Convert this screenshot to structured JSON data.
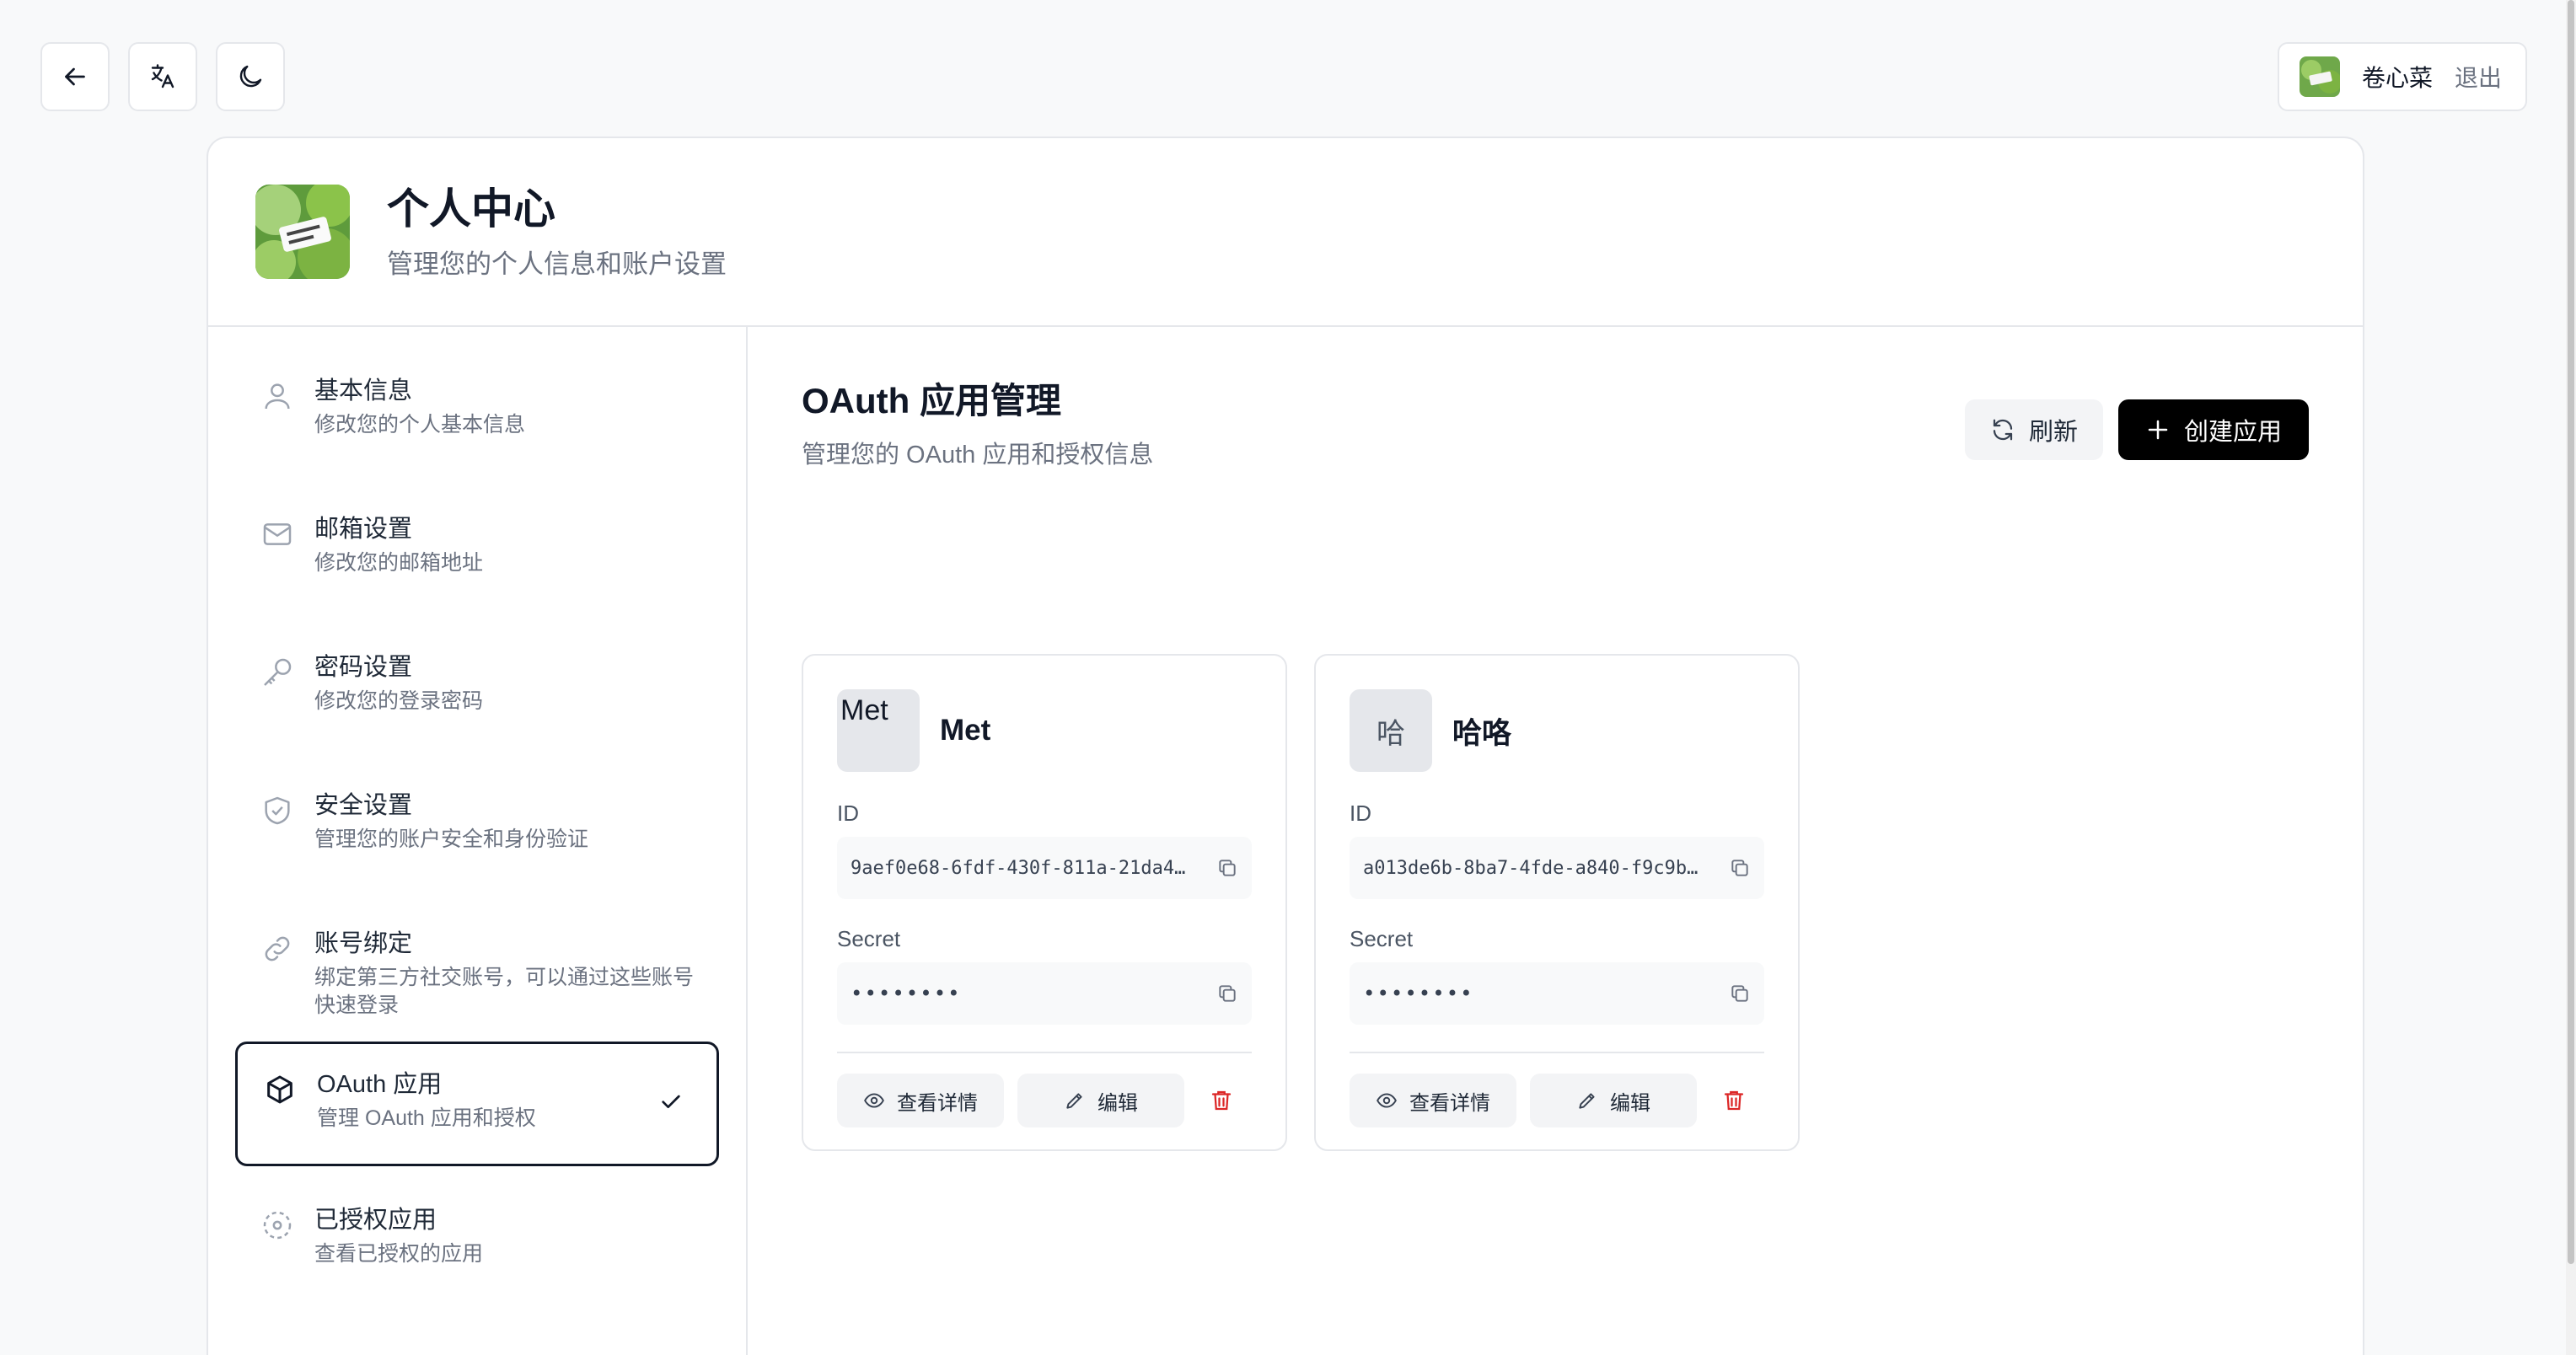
{
  "topbar": {
    "back_icon": "arrow-left-icon",
    "language_icon": "translate-icon",
    "theme_icon": "moon-icon",
    "user_name": "卷心菜",
    "logout_label": "退出"
  },
  "header": {
    "title": "个人中心",
    "subtitle": "管理您的个人信息和账户设置"
  },
  "sidebar": {
    "items": [
      {
        "label": "基本信息",
        "desc": "修改您的个人基本信息",
        "icon": "user-icon"
      },
      {
        "label": "邮箱设置",
        "desc": "修改您的邮箱地址",
        "icon": "mail-icon"
      },
      {
        "label": "密码设置",
        "desc": "修改您的登录密码",
        "icon": "key-icon"
      },
      {
        "label": "安全设置",
        "desc": "管理您的账户安全和身份验证",
        "icon": "shield-check-icon"
      },
      {
        "label": "账号绑定",
        "desc": "绑定第三方社交账号，可以通过这些账号快速登录",
        "icon": "link-icon"
      },
      {
        "label": "OAuth 应用",
        "desc": "管理 OAuth 应用和授权",
        "icon": "box-icon",
        "active": true
      },
      {
        "label": "已授权应用",
        "desc": "查看已授权的应用",
        "icon": "scan-icon"
      }
    ]
  },
  "main": {
    "title": "OAuth 应用管理",
    "subtitle": "管理您的 OAuth 应用和授权信息",
    "refresh_label": "刷新",
    "create_label": "创建应用"
  },
  "apps": [
    {
      "logo_text": "Met",
      "name": "Met",
      "id_label": "ID",
      "id_value": "9aef0e68-6fdf-430f-811a-21da4…",
      "secret_label": "Secret",
      "secret_value": "••••••••",
      "view_label": "查看详情",
      "edit_label": "编辑"
    },
    {
      "logo_text": "哈",
      "name": "哈咯",
      "id_label": "ID",
      "id_value": "a013de6b-8ba7-4fde-a840-f9c9b…",
      "secret_label": "Secret",
      "secret_value": "••••••••",
      "view_label": "查看详情",
      "edit_label": "编辑"
    }
  ],
  "colors": {
    "accent": "#000000",
    "danger": "#dc2626",
    "border": "#e5e7eb",
    "muted_text": "#6b7280"
  }
}
